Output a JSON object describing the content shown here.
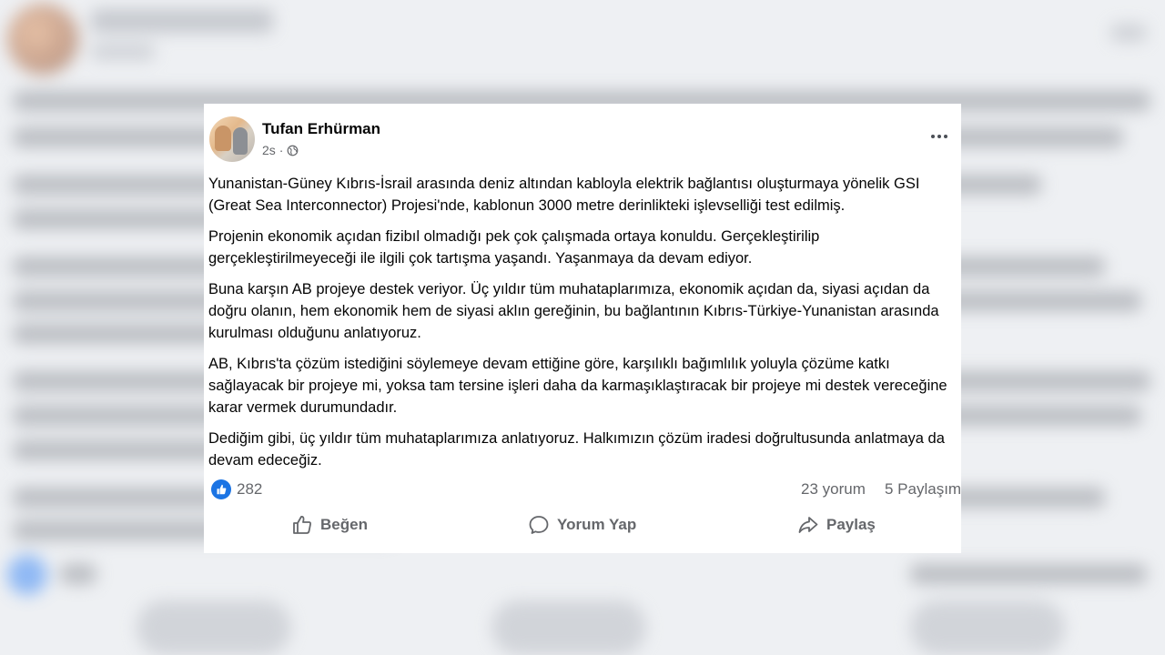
{
  "post": {
    "author": "Tufan Erhürman",
    "time": "2s",
    "separator": "·",
    "paragraphs": [
      "Yunanistan-Güney Kıbrıs-İsrail arasında deniz altından kabloyla elektrik bağlantısı oluşturmaya yönelik GSI (Great Sea Interconnector) Projesi'nde, kablonun 3000 metre derinlikteki işlevselliği test edilmiş.",
      "Projenin ekonomik açıdan fizibıl olmadığı pek çok çalışmada ortaya konuldu. Gerçekleştirilip gerçekleştirilmeyeceği ile ilgili çok tartışma yaşandı. Yaşanmaya da devam ediyor.",
      "Buna karşın AB projeye destek veriyor. Üç yıldır tüm muhataplarımıza, ekonomik açıdan da, siyasi açıdan da doğru olanın, hem ekonomik hem de siyasi aklın gereğinin, bu bağlantının Kıbrıs-Türkiye-Yunanistan arasında kurulması olduğunu anlatıyoruz.",
      "AB, Kıbrıs'ta çözüm istediğini söylemeye devam ettiğine göre, karşılıklı bağımlılık yoluyla çözüme katkı sağlayacak bir projeye mi, yoksa tam tersine işleri daha da karmaşıklaştıracak bir projeye mi destek vereceğine karar vermek durumundadır.",
      "Dediğim gibi, üç yıldır tüm muhataplarımıza anlatıyoruz. Halkımızın çözüm iradesi doğrultusunda anlatmaya da devam edeceğiz."
    ],
    "reactions_count": "282",
    "comments": "23 yorum",
    "shares": "5 Paylaşım"
  },
  "actions": {
    "like": "Beğen",
    "comment": "Yorum Yap",
    "share": "Paylaş"
  },
  "icons": {
    "more": "more-dots-icon",
    "audience": "globe-icon",
    "reaction": "thumbs-up-icon",
    "like": "thumbs-up-outline-icon",
    "comment": "comment-bubble-icon",
    "share": "share-arrow-icon"
  },
  "colors": {
    "accent": "#1b74e4",
    "secondary_text": "#65676b",
    "primary_text": "#050505"
  }
}
